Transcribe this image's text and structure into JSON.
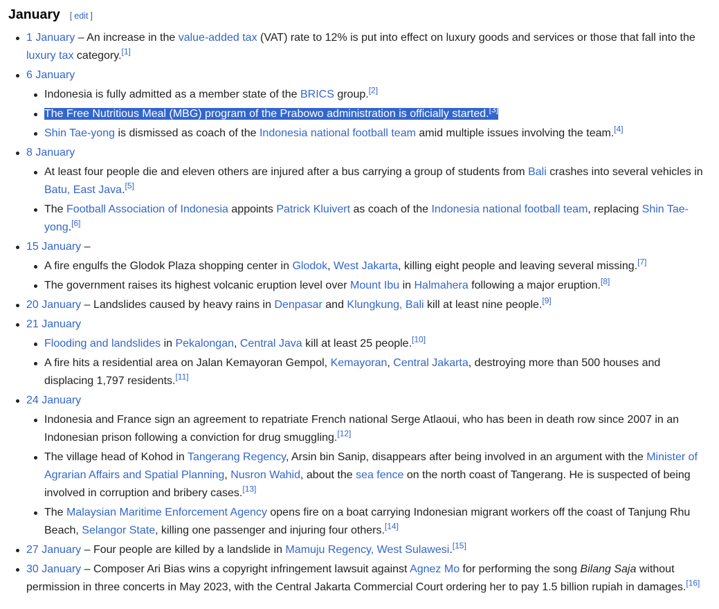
{
  "heading": {
    "title": "January",
    "edit_open": "[",
    "edit_label": "edit",
    "edit_close": "]"
  },
  "entries": [
    {
      "date": "1 January",
      "text": [
        {
          "t": " – An increase in the "
        },
        {
          "t": "value-added tax",
          "link": true
        },
        {
          "t": " (VAT) rate to 12% is put into effect on luxury goods and services or those that fall into the "
        },
        {
          "t": "luxury tax",
          "link": true
        },
        {
          "t": " category."
        },
        {
          "t": "[1]",
          "ref": true
        }
      ]
    },
    {
      "date": "6 January",
      "text": [],
      "items": [
        [
          {
            "t": "Indonesia is fully admitted as a member state of the "
          },
          {
            "t": "BRICS",
            "link": true
          },
          {
            "t": " group."
          },
          {
            "t": "[2]",
            "ref": true
          }
        ],
        [
          {
            "t": "The Free Nutritious Meal (MBG) program of the Prabowo administration is officially started.",
            "hl": true
          },
          {
            "t": "[3]",
            "ref": true,
            "hl": true
          }
        ],
        [
          {
            "t": "Shin Tae-yong",
            "link": true
          },
          {
            "t": " is dismissed as coach of the "
          },
          {
            "t": "Indonesia national football team",
            "link": true
          },
          {
            "t": " amid multiple issues involving the team."
          },
          {
            "t": "[4]",
            "ref": true
          }
        ]
      ]
    },
    {
      "date": "8 January",
      "text": [],
      "items": [
        [
          {
            "t": "At least four people die and eleven others are injured after a bus carrying a group of students from "
          },
          {
            "t": "Bali",
            "link": true
          },
          {
            "t": " crashes into several vehicles in "
          },
          {
            "t": "Batu, East Java",
            "link": true
          },
          {
            "t": "."
          },
          {
            "t": "[5]",
            "ref": true
          }
        ],
        [
          {
            "t": "The "
          },
          {
            "t": "Football Association of Indonesia",
            "link": true
          },
          {
            "t": " appoints "
          },
          {
            "t": "Patrick Kluivert",
            "link": true
          },
          {
            "t": " as coach of the "
          },
          {
            "t": "Indonesia national football team",
            "link": true
          },
          {
            "t": ", replacing "
          },
          {
            "t": "Shin Tae-yong",
            "link": true
          },
          {
            "t": "."
          },
          {
            "t": "[6]",
            "ref": true
          }
        ]
      ]
    },
    {
      "date": "15 January",
      "text": [
        {
          "t": " –"
        }
      ],
      "items": [
        [
          {
            "t": "A fire engulfs the Glodok Plaza shopping center in "
          },
          {
            "t": "Glodok",
            "link": true
          },
          {
            "t": ", "
          },
          {
            "t": "West Jakarta",
            "link": true
          },
          {
            "t": ", killing eight people and leaving several missing."
          },
          {
            "t": "[7]",
            "ref": true
          }
        ],
        [
          {
            "t": "The government raises its highest volcanic eruption level over "
          },
          {
            "t": "Mount Ibu",
            "link": true
          },
          {
            "t": " in "
          },
          {
            "t": "Halmahera",
            "link": true
          },
          {
            "t": " following a major eruption."
          },
          {
            "t": "[8]",
            "ref": true
          }
        ]
      ]
    },
    {
      "date": "20 January",
      "text": [
        {
          "t": " – Landslides caused by heavy rains in "
        },
        {
          "t": "Denpasar",
          "link": true
        },
        {
          "t": " and "
        },
        {
          "t": "Klungkung, Bali",
          "link": true
        },
        {
          "t": " kill at least nine people."
        },
        {
          "t": "[9]",
          "ref": true
        }
      ]
    },
    {
      "date": "21 January",
      "text": [],
      "items": [
        [
          {
            "t": "Flooding and landslides",
            "link": true
          },
          {
            "t": " in "
          },
          {
            "t": "Pekalongan",
            "link": true
          },
          {
            "t": ", "
          },
          {
            "t": "Central Java",
            "link": true
          },
          {
            "t": " kill at least 25 people."
          },
          {
            "t": "[10]",
            "ref": true
          }
        ],
        [
          {
            "t": "A fire hits a residential area on Jalan Kemayoran Gempol, "
          },
          {
            "t": "Kemayoran",
            "link": true
          },
          {
            "t": ", "
          },
          {
            "t": "Central Jakarta",
            "link": true
          },
          {
            "t": ", destroying more than 500 houses and displacing 1,797 residents."
          },
          {
            "t": "[11]",
            "ref": true
          }
        ]
      ]
    },
    {
      "date": "24 January",
      "text": [],
      "items": [
        [
          {
            "t": "Indonesia and France sign an agreement to repatriate French national Serge Atlaoui, who has been in death row since 2007 in an Indonesian prison following a conviction for drug smuggling."
          },
          {
            "t": "[12]",
            "ref": true
          }
        ],
        [
          {
            "t": "The village head of Kohod in "
          },
          {
            "t": "Tangerang Regency",
            "link": true
          },
          {
            "t": ", Arsin bin Sanip, disappears after being involved in an argument with the "
          },
          {
            "t": "Minister of Agrarian Affairs and Spatial Planning",
            "link": true
          },
          {
            "t": ", "
          },
          {
            "t": "Nusron Wahid",
            "link": true
          },
          {
            "t": ", about the "
          },
          {
            "t": "sea fence",
            "link": true
          },
          {
            "t": " on the north coast of Tangerang. He is suspected of being involved in corruption and bribery cases."
          },
          {
            "t": "[13]",
            "ref": true
          }
        ],
        [
          {
            "t": "The "
          },
          {
            "t": "Malaysian Maritime Enforcement Agency",
            "link": true
          },
          {
            "t": " opens fire on a boat carrying Indonesian migrant workers off the coast of Tanjung Rhu Beach, "
          },
          {
            "t": "Selangor State",
            "link": true
          },
          {
            "t": ", killing one passenger and injuring four others."
          },
          {
            "t": "[14]",
            "ref": true
          }
        ]
      ]
    },
    {
      "date": "27 January",
      "text": [
        {
          "t": " – Four people are killed by a landslide in "
        },
        {
          "t": "Mamuju Regency, West Sulawesi",
          "link": true
        },
        {
          "t": "."
        },
        {
          "t": "[15]",
          "ref": true
        }
      ]
    },
    {
      "date": "30 January",
      "text": [
        {
          "t": " – Composer Ari Bias wins a copyright infringement lawsuit against "
        },
        {
          "t": "Agnez Mo",
          "link": true
        },
        {
          "t": " for performing the song "
        },
        {
          "t": "Bilang Saja",
          "em": true
        },
        {
          "t": " without permission in three concerts in May 2023, with the Central Jakarta Commercial Court ordering her to pay 1.5 billion rupiah in damages."
        },
        {
          "t": "[16]",
          "ref": true
        }
      ]
    }
  ]
}
